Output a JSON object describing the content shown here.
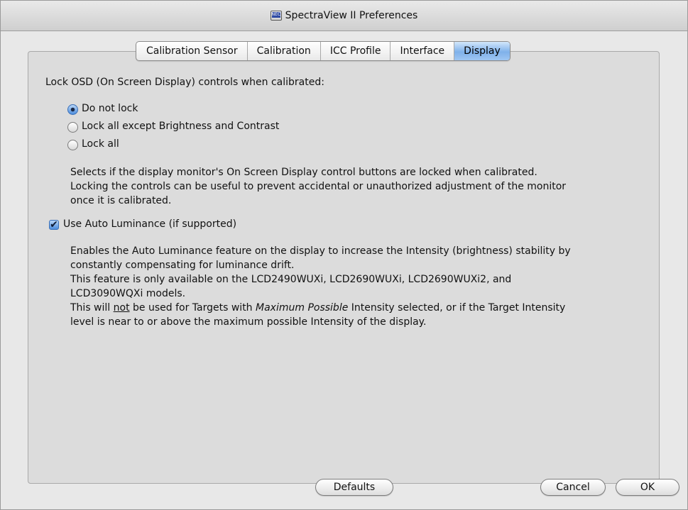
{
  "window": {
    "title": "SpectraView II Preferences",
    "icon": "nec-app-icon",
    "icon_text": "NEC"
  },
  "tabs": [
    {
      "label": "Calibration Sensor",
      "selected": false
    },
    {
      "label": "Calibration",
      "selected": false
    },
    {
      "label": "ICC Profile",
      "selected": false
    },
    {
      "label": "Interface",
      "selected": false
    },
    {
      "label": "Display",
      "selected": true
    }
  ],
  "display": {
    "lock_heading": "Lock OSD (On Screen Display) controls when calibrated:",
    "lock_options": [
      {
        "label": "Do not lock",
        "selected": true
      },
      {
        "label": "Lock all except Brightness and Contrast",
        "selected": false
      },
      {
        "label": "Lock all",
        "selected": false
      }
    ],
    "lock_description": [
      "Selects if the display monitor's On Screen Display control buttons are locked when calibrated.",
      "Locking the controls can be useful to prevent accidental or unauthorized adjustment of the monitor",
      "once it is calibrated."
    ],
    "auto_luminance": {
      "label": "Use Auto Luminance (if supported)",
      "checked": true,
      "check_glyph": "✔",
      "description": [
        "Enables the Auto Luminance feature on the display to increase the Intensity (brightness) stability by",
        "constantly compensating for luminance drift.",
        "This feature is only available on the LCD2490WUXi, LCD2690WUXi, LCD2690WUXi2, and",
        "LCD3090WQXi models."
      ],
      "note": {
        "prefix": "This will ",
        "emphasis_not": "not",
        "middle": " be used for Targets with ",
        "emphasis_target": "Maximum Possible",
        "suffix": " Intensity selected, or if the Target Intensity",
        "line2": "level is near to or above the maximum possible Intensity of the display."
      }
    }
  },
  "buttons": {
    "defaults": "Defaults",
    "cancel": "Cancel",
    "ok": "OK"
  },
  "colors": {
    "selected_tab": "#7fb1ea",
    "window_bg": "#e8e8e8",
    "panel_bg": "#dcdcdc"
  }
}
